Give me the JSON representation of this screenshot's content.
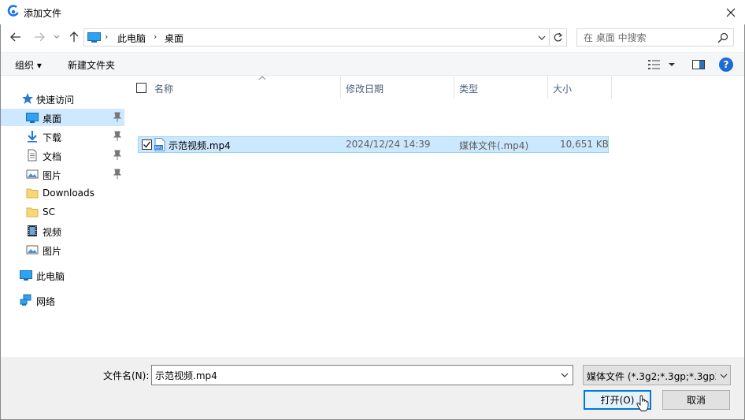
{
  "window": {
    "title": "添加文件",
    "colors": {
      "accent": "#0078d7",
      "selection": "#cce8ff",
      "selection_border": "#99d1ff",
      "help": "#1e6bd6"
    }
  },
  "address": {
    "crumbs": [
      "此电脑",
      "桌面"
    ],
    "search_placeholder": "在 桌面 中搜索"
  },
  "toolbar": {
    "organize_label": "组织 ▾",
    "new_folder_label": "新建文件夹",
    "help_label": "?"
  },
  "nav": {
    "quick_access": "快速访问",
    "items": [
      {
        "label": "桌面",
        "icon": "desktop-icon",
        "pinned": true,
        "selected": true
      },
      {
        "label": "下载",
        "icon": "download-icon",
        "pinned": true
      },
      {
        "label": "文档",
        "icon": "document-icon",
        "pinned": true
      },
      {
        "label": "图片",
        "icon": "picture-icon",
        "pinned": true
      },
      {
        "label": "Downloads",
        "icon": "folder-icon",
        "pinned": false
      },
      {
        "label": "SC",
        "icon": "folder-icon",
        "pinned": false
      },
      {
        "label": "视频",
        "icon": "video-icon",
        "pinned": false
      },
      {
        "label": "图片",
        "icon": "picture-icon",
        "pinned": false
      }
    ],
    "this_pc": "此电脑",
    "network": "网络"
  },
  "columns": [
    "名称",
    "修改日期",
    "类型",
    "大小"
  ],
  "files": [
    {
      "name": "示范视频.mp4",
      "modified": "2024/12/24 14:39",
      "type": "媒体文件(.mp4)",
      "size": "10,651 KB",
      "checked": true,
      "icon": "mp4-file-icon"
    }
  ],
  "bottom": {
    "filename_label": "文件名(N):",
    "filename_value": "示范视频.mp4",
    "filetype_value": "媒体文件 (*.3g2;*.3gp;*.3gp2;",
    "open_label": "打开(O)",
    "cancel_label": "取消"
  }
}
